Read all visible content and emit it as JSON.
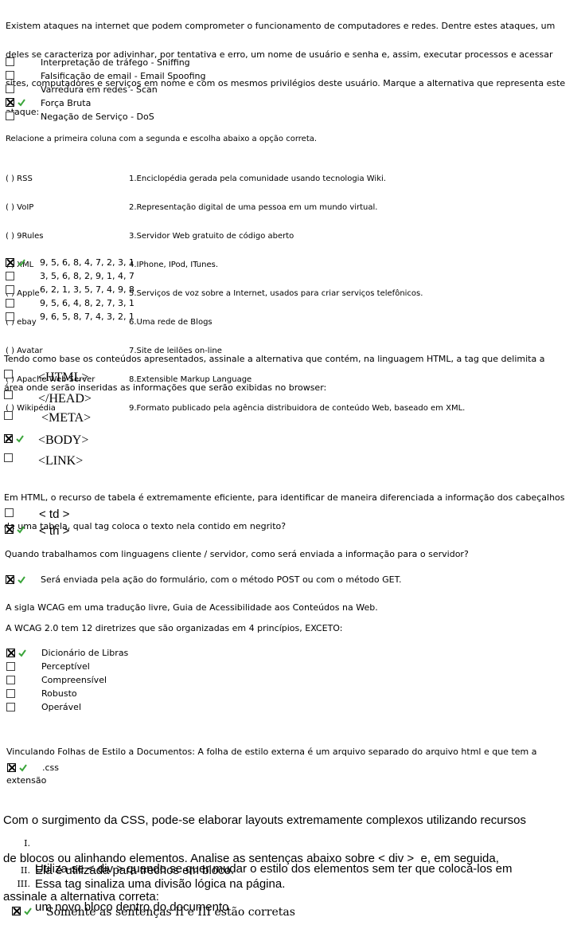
{
  "q1": {
    "prompt": [
      "Existem ataques na internet que podem comprometer o funcionamento de computadores e redes. Dentre estes ataques, um",
      "deles se caracteriza por adivinhar, por tentativa e erro, um nome de usuário e senha e, assim, executar processos e acessar",
      "sites, computadores e serviços em nome e com os mesmos privilégios deste usuário. Marque a alternativa que representa este",
      "ataque:"
    ],
    "options": [
      "Interpretação de tráfego - Sniffing",
      "Falsificação de email - Email Spoofing",
      "Varredura em redes - Scan",
      "Força Bruta",
      "Negação de Serviço - DoS"
    ]
  },
  "q2": {
    "prompt": "Relacione a primeira coluna com a segunda e escolha abaixo a opção correta.",
    "left": [
      "( ) RSS",
      "( ) VoIP",
      "( ) 9Rules",
      "( ) XML",
      "( ) Apple",
      "( ) ebay",
      "( ) Avatar",
      "( ) Apache Web Server",
      "( ) Wikipédia"
    ],
    "right": [
      "1.Enciclopédia gerada pela comunidade usando tecnologia Wiki.",
      "2.Representação digital de uma pessoa em um mundo virtual.",
      "3.Servidor Web gratuito de código aberto",
      "4.IPhone, IPod, ITunes.",
      "5.Serviços de voz sobre a Internet, usados para criar serviços telefônicos.",
      "6.Uma rede de Blogs",
      "7.Site de leilões on-line",
      "8.Extensible Markup Language",
      "9.Formato publicado pela agência distribuidora de conteúdo Web, baseado em XML."
    ],
    "options": [
      "9, 5, 6, 8, 4, 7, 2, 3, 1",
      "3, 5, 6, 8, 2, 9, 1, 4, 7",
      "6, 2, 1, 3, 5, 7, 4, 9, 8",
      "9, 5, 6, 4, 8, 2, 7, 3, 1",
      "9, 6, 5, 8, 7, 4, 3, 2, 1"
    ]
  },
  "q3": {
    "prompt": [
      "Tendo como base os conteúdos apresentados, assinale a alternativa que contém, na linguagem HTML, a tag que delimita a",
      "área onde serão inseridas as informações que serão exibidas no browser:"
    ],
    "options": [
      "<HTML>",
      "</HEAD>",
      "<META>",
      "<BODY>",
      "<LINK>"
    ]
  },
  "q4": {
    "prompt": [
      "Em HTML, o recurso de tabela é extremamente eficiente, para identificar de maneira diferenciada a informação dos cabeçalhos",
      "de uma tabela, qual tag coloca o texto nela contido em negrito?"
    ],
    "options": [
      "< td >",
      "< th >"
    ]
  },
  "q5": {
    "prompt": "Quando trabalhamos com linguagens cliente / servidor, como será enviada a informação para o servidor?",
    "options": [
      "Será enviada pela ação do formulário, com o método POST ou com o método GET."
    ]
  },
  "q6": {
    "intro": "A sigla WCAG em uma tradução livre, Guia de Acessibilidade aos Conteúdos na Web.",
    "prompt": "A WCAG 2.0 tem 12 diretrizes que são organizadas em 4 princípios, EXCETO:",
    "options": [
      "Dicionário de Libras",
      "Perceptível",
      "Compreensível",
      "Robusto",
      "Operável"
    ]
  },
  "q7": {
    "prompt": [
      "Vinculando Folhas de Estilo a Documentos: A folha de estilo externa é um arquivo separado do arquivo html e que tem a",
      "extensão"
    ],
    "options": [
      ".css"
    ]
  },
  "q8": {
    "prompt": [
      "Com o surgimento da CSS, pode-se elaborar layouts extremamente complexos utilizando recursos",
      "de blocos ou alinhando elementos. Analise as sentenças abaixo sobre < div >  e, em seguida,",
      "assinale a alternativa correta:"
    ],
    "statements": [
      {
        "num": "I.",
        "lines": [
          "Utiliza-se < div > quando se quer mudar o estilo dos elementos sem ter que colocá-los em",
          "um novo bloco dentro do documento"
        ]
      },
      {
        "num": "II.",
        "lines": [
          "Ela é utilizada para trechos em bloco."
        ]
      },
      {
        "num": "III.",
        "lines": [
          "Essa tag sinaliza uma divisão lógica na página."
        ]
      }
    ],
    "options": [
      "Somente as sentenças II e III estão corretas"
    ]
  },
  "icons": {
    "checked": "checked-box-icon",
    "unchecked": "empty-box-icon",
    "correct": "green-check-icon"
  },
  "colors": {
    "correct_mark": "#3aa53a"
  }
}
